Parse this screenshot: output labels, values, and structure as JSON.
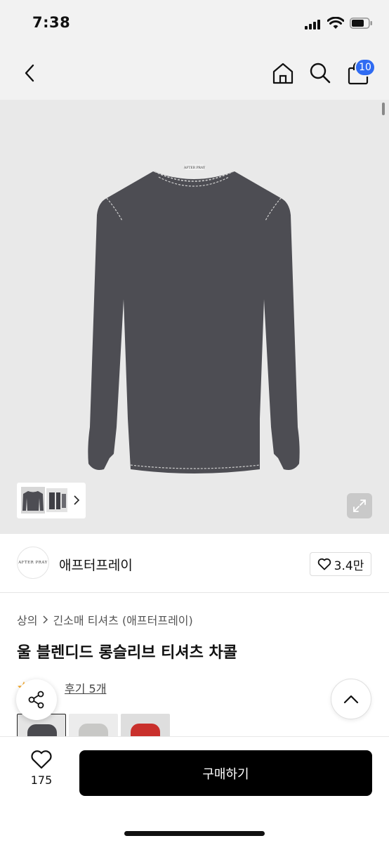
{
  "status_bar": {
    "time": "7:38"
  },
  "nav": {
    "cart_count": "10"
  },
  "gallery": {
    "shirt_label": "AFTER PRAY"
  },
  "brand": {
    "logo_text": "AFTER PRAY",
    "name": "애프터프레이",
    "likes": "3.4만"
  },
  "breadcrumb": {
    "category": "상의",
    "subcategory": "긴소매 티셔츠 (애프터프레이)"
  },
  "product": {
    "title": "울 블렌디드 롱슬리브 티셔츠 차콜"
  },
  "reviews": {
    "link_text": "후기 5개"
  },
  "swatches": [
    {
      "name": "charcoal",
      "color": "#4a4a4f"
    },
    {
      "name": "gray",
      "color": "#c8c8c6"
    },
    {
      "name": "red",
      "color": "#c9302c"
    }
  ],
  "bottom": {
    "wish_count": "175",
    "buy_label": "구매하기"
  },
  "colors": {
    "accent_badge": "#2f6bf2",
    "buy_button": "#000000",
    "star": "#f5a623"
  }
}
